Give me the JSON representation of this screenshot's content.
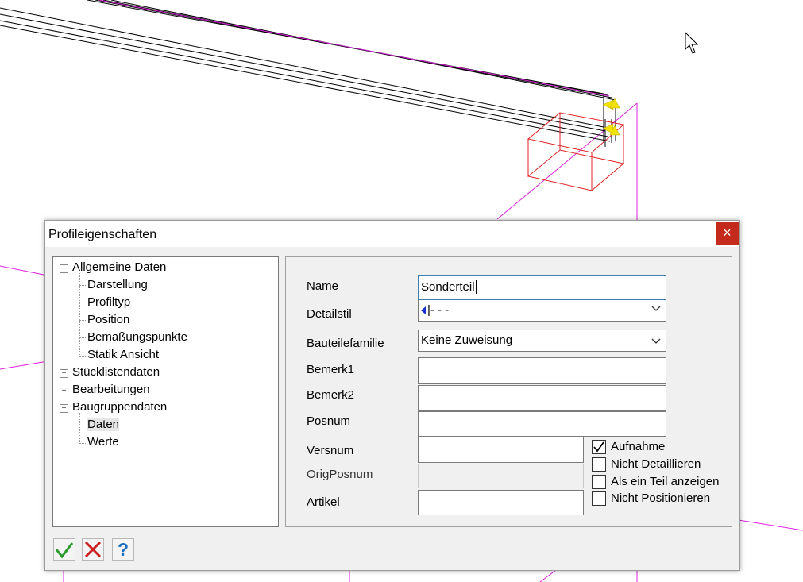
{
  "dialog": {
    "title": "Profileigenschaften",
    "close_glyph": "×"
  },
  "tree": {
    "items": [
      {
        "label": "Allgemeine Daten",
        "expander": "−"
      },
      {
        "label": "Darstellung"
      },
      {
        "label": "Profiltyp"
      },
      {
        "label": "Position"
      },
      {
        "label": "Bemaßungspunkte"
      },
      {
        "label": "Statik Ansicht"
      },
      {
        "label": "Stücklistendaten",
        "expander": "+"
      },
      {
        "label": "Bearbeitungen",
        "expander": "+"
      },
      {
        "label": "Baugruppendaten",
        "expander": "−"
      },
      {
        "label": "Daten"
      },
      {
        "label": "Werte"
      }
    ]
  },
  "form": {
    "name": {
      "label": "Name",
      "value": "Sonderteil"
    },
    "detailstil": {
      "label": "Detailstil",
      "value": "|- - -"
    },
    "bauteilefamilie": {
      "label": "Bauteilefamilie",
      "value": "Keine Zuweisung"
    },
    "bemerk1": {
      "label": "Bemerk1",
      "value": ""
    },
    "bemerk2": {
      "label": "Bemerk2",
      "value": ""
    },
    "posnum": {
      "label": "Posnum",
      "value": ""
    },
    "versnum": {
      "label": "Versnum",
      "value": ""
    },
    "origposnum": {
      "label": "OrigPosnum",
      "value": ""
    },
    "artikel": {
      "label": "Artikel",
      "value": ""
    }
  },
  "checkboxes": [
    {
      "label": "Aufnahme",
      "checked": true
    },
    {
      "label": "Nicht Detaillieren",
      "checked": false
    },
    {
      "label": "Als ein Teil anzeigen",
      "checked": false
    },
    {
      "label": "Nicht Positionieren",
      "checked": false
    }
  ],
  "toolbar": {
    "help_glyph": "?"
  },
  "icons": {
    "ok": "checkmark-icon",
    "cancel": "cancel-icon",
    "help": "help-icon"
  },
  "colors": {
    "close_bg": "#c42b1c",
    "ok_green": "#2e9b2e",
    "cancel_red": "#cc1f1f",
    "help_blue": "#1f6fbf",
    "selection_red": "#e02020",
    "grid_magenta": "#e020e0"
  }
}
